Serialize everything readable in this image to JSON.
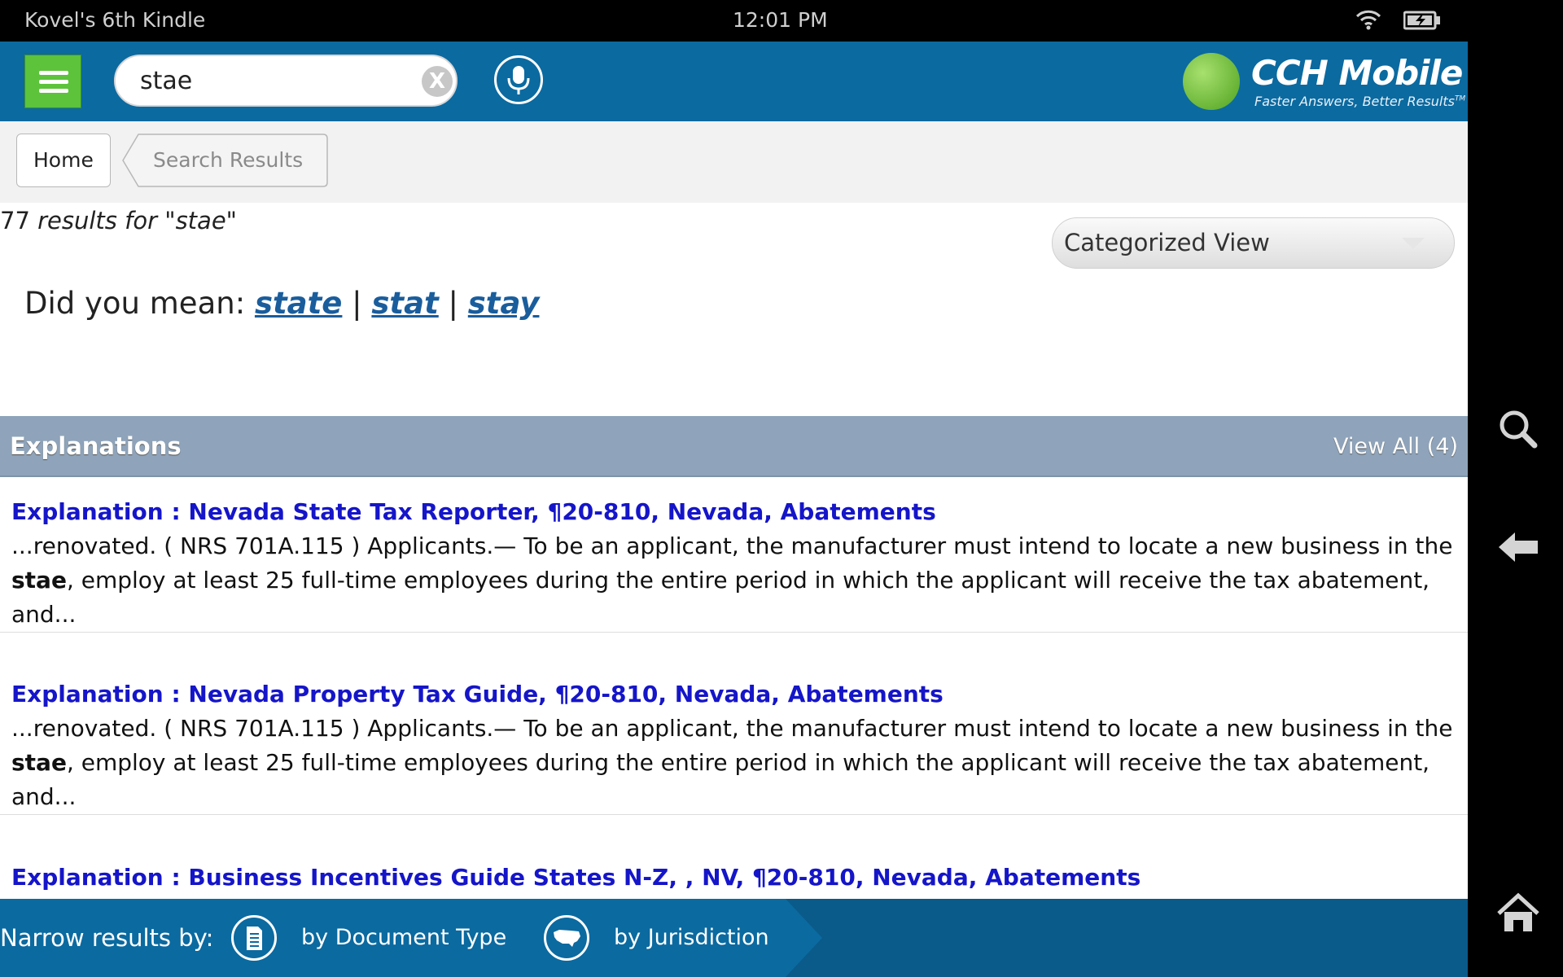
{
  "status_bar": {
    "device_name": "Kovel's 6th Kindle",
    "time": "12:01 PM",
    "icons": [
      "wifi-icon",
      "battery-icon"
    ]
  },
  "header": {
    "menu_icon": "hamburger-menu-icon",
    "search": {
      "value": "stae",
      "clear_label": "X"
    },
    "mic_icon": "microphone-icon",
    "logo": {
      "brand": "CCH Mobile",
      "tagline": "Faster Answers, Better Results",
      "trademark": "TM"
    }
  },
  "breadcrumb": {
    "home": "Home",
    "current": "Search Results"
  },
  "results_summary": {
    "count": "77",
    "text": " results for \"stae\""
  },
  "view_select": {
    "selected": "Categorized View"
  },
  "did_you_mean": {
    "label": "Did you mean:",
    "suggestions": [
      "state",
      "stat",
      "stay"
    ],
    "separator": "|"
  },
  "section": {
    "title": "Explanations",
    "view_all": "View All (4)"
  },
  "results": [
    {
      "title": "Explanation : Nevada State Tax Reporter, ¶20-810, Nevada, Abatements",
      "snippet_pre": "...renovated. ( NRS 701A.115 ) Applicants.— To be an applicant, the manufacturer must intend to locate a new business in the ",
      "snippet_match": "stae",
      "snippet_post": ", employ at least 25 full-time employees during the entire period in which the applicant will receive the tax abatement, and..."
    },
    {
      "title": "Explanation : Nevada Property Tax Guide, ¶20-810, Nevada, Abatements",
      "snippet_pre": "...renovated. ( NRS 701A.115 ) Applicants.— To be an applicant, the manufacturer must intend to locate a new business in the ",
      "snippet_match": "stae",
      "snippet_post": ", employ at least 25 full-time employees during the entire period in which the applicant will receive the tax abatement, and..."
    },
    {
      "title": "Explanation : Business Incentives Guide States N-Z, , NV, ¶20-810, Nevada, Abatements",
      "snippet_pre": "",
      "snippet_match": "",
      "snippet_post": ""
    }
  ],
  "bottom_bar": {
    "narrow_label": "Narrow results by:",
    "by_document_type": "by Document Type",
    "by_jurisdiction": "by Jurisdiction",
    "icons": [
      "document-icon",
      "us-map-icon"
    ]
  },
  "side_nav": {
    "icons": [
      "search-icon",
      "back-arrow-icon",
      "home-icon"
    ]
  },
  "colors": {
    "header_blue": "#0b6aa0",
    "menu_green": "#5cc33b",
    "section_header": "#8fa4ba",
    "result_title": "#1515c9",
    "suggestion_link": "#1a5d9c"
  }
}
